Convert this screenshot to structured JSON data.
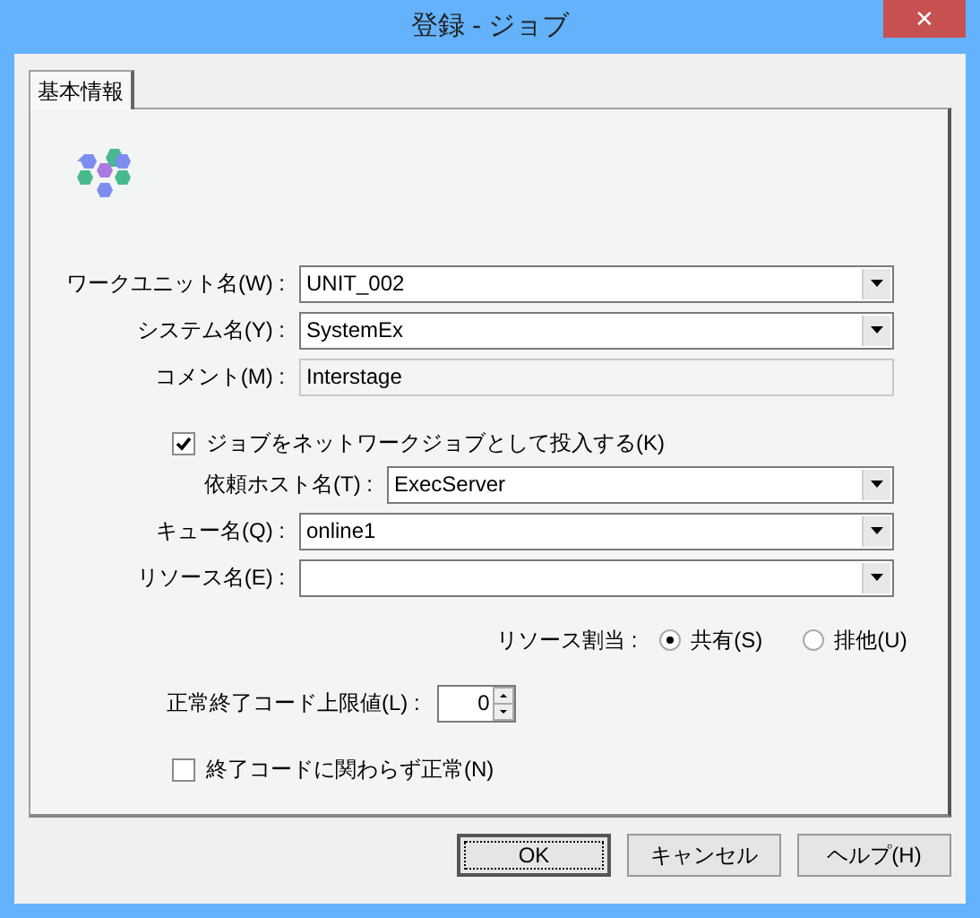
{
  "window": {
    "title": "登録 - ジョブ",
    "close": "✕"
  },
  "tabs": [
    {
      "label": "基本情報",
      "selected": true
    }
  ],
  "fields": [
    {
      "kind": "combo",
      "label": "ワークユニット名(W) :",
      "value": "UNIT_002"
    },
    {
      "kind": "combo",
      "label": "システム名(Y) :",
      "value": "SystemEx"
    },
    {
      "kind": "text",
      "label": "コメント(M) :",
      "value": "Interstage"
    }
  ],
  "network_job": {
    "label": "ジョブをネットワークジョブとして投入する(K)",
    "checked": true
  },
  "host_field": {
    "kind": "combo",
    "label": "依頼ホスト名(T) :",
    "value": "ExecServer"
  },
  "queue_fields": [
    {
      "kind": "combo",
      "label": "キュー名(Q) :",
      "value": "online1"
    },
    {
      "kind": "combo",
      "label": "リソース名(E) :"
    }
  ],
  "resource_allocation": {
    "label": "リソース割当 :",
    "options": [
      {
        "label": "共有(S)",
        "selected": true
      },
      {
        "label": "排他(U)",
        "selected": false
      }
    ]
  },
  "exit_code_limit": {
    "label": "正常終了コード上限値(L) :",
    "value": "0"
  },
  "ignore_exit_code": {
    "label": "終了コードに関わらず正常(N)",
    "checked": false
  },
  "buttons": [
    {
      "label": "OK",
      "default": true
    },
    {
      "label": "キャンセル",
      "default": false
    },
    {
      "label": "ヘルプ(H)",
      "default": false
    }
  ]
}
